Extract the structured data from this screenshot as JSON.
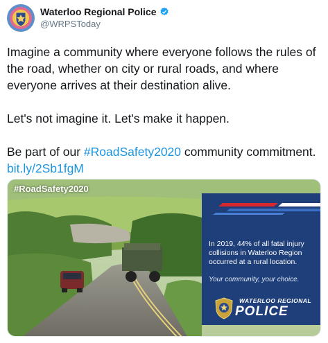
{
  "tweet": {
    "author": {
      "display_name": "Waterloo Regional Police",
      "handle": "@WRPSToday",
      "verified": true,
      "avatar_icon": "police-crest-icon"
    },
    "text": {
      "para1": "Imagine a community where everyone follows the rules of the road, whether on city or rural roads, and where everyone arrives at their destination alive.",
      "para2": "Let's not imagine it. Let's make it happen.",
      "para3_prefix": "Be part of our ",
      "hashtag": "#RoadSafety2020",
      "para3_middle": " community commitment. ",
      "link": "bit.ly/2Sb1fgM"
    }
  },
  "media": {
    "hashtag_overlay": "#RoadSafety2020",
    "panel": {
      "stat": "In 2019, 44% of all fatal injury collisions in Waterloo Region occurred at a rural location.",
      "tagline": "Your community, your choice.",
      "logo_top": "WATERLOO REGIONAL",
      "logo_main": "POLICE"
    }
  },
  "colors": {
    "link": "#1b95e0",
    "verified": "#1da1f2",
    "panel_bg": "#1f3f7a"
  }
}
